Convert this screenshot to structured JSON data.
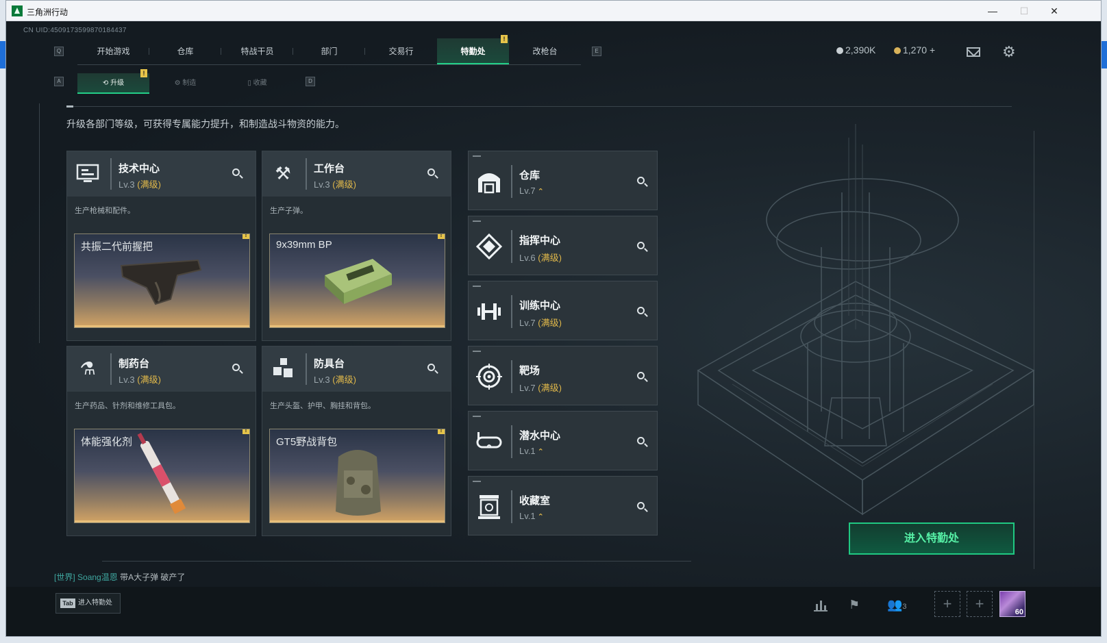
{
  "window": {
    "title": "三角洲行动",
    "controls": [
      "—",
      "☐",
      "✕"
    ]
  },
  "uid": "CN UID:4509173599870184437",
  "keys": {
    "left": "Q",
    "right": "E",
    "sub_left": "A",
    "sub_right": "D"
  },
  "nav": {
    "tabs": [
      "开始游戏",
      "仓库",
      "特战干员",
      "部门",
      "交易行",
      "特勤处",
      "改枪台"
    ],
    "active": "特勤处"
  },
  "subnav": {
    "tabs": [
      "升级",
      "制造",
      "收藏"
    ],
    "active": "升级"
  },
  "currency": {
    "silver": "2,390K",
    "gold": "1,270",
    "gold_add": "+"
  },
  "description": "升级各部门等级，可获得专属能力提升，和制造战斗物资的能力。",
  "cards": [
    {
      "name": "技术中心",
      "level": "Lv.3",
      "maxed": "(满级)",
      "desc": "生产枪械和配件。",
      "product": "共振二代前握把",
      "icon": "computer-icon"
    },
    {
      "name": "工作台",
      "level": "Lv.3",
      "maxed": "(满级)",
      "desc": "生产子弹。",
      "product": "9x39mm BP",
      "icon": "hammer-wrench-icon"
    },
    {
      "name": "制药台",
      "level": "Lv.3",
      "maxed": "(满级)",
      "desc": "生产药品、针剂和维修工具包。",
      "product": "体能强化剂",
      "icon": "flask-icon"
    },
    {
      "name": "防具台",
      "level": "Lv.3",
      "maxed": "(满级)",
      "desc": "生产头盔、护甲、胸挂和背包。",
      "product": "GT5野战背包",
      "icon": "armor-blocks-icon"
    }
  ],
  "facilities": [
    {
      "name": "仓库",
      "level": "Lv.7",
      "status": "",
      "upgradable": true,
      "icon": "warehouse-icon"
    },
    {
      "name": "指挥中心",
      "level": "Lv.6",
      "status": "(满级)",
      "upgradable": false,
      "icon": "command-icon"
    },
    {
      "name": "训练中心",
      "level": "Lv.7",
      "status": "(满级)",
      "upgradable": false,
      "icon": "dumbbell-icon"
    },
    {
      "name": "靶场",
      "level": "Lv.7",
      "status": "(满级)",
      "upgradable": false,
      "icon": "target-icon"
    },
    {
      "name": "潜水中心",
      "level": "Lv.1",
      "status": "",
      "upgradable": true,
      "icon": "diving-goggles-icon"
    },
    {
      "name": "收藏室",
      "level": "Lv.1",
      "status": "",
      "upgradable": true,
      "icon": "collection-icon"
    }
  ],
  "enter_button": "进入特勤处",
  "chat": {
    "channel": "[世界]",
    "user": "Soang温恩",
    "message": "带A大子弹 破产了"
  },
  "bottom": {
    "tab_key": "Tab",
    "tab_label": "进入特勤处",
    "friends_count": "3",
    "avatar_level": "60"
  },
  "colors": {
    "accent": "#23d088",
    "gold": "#e0b84a",
    "background": "#141b21"
  }
}
